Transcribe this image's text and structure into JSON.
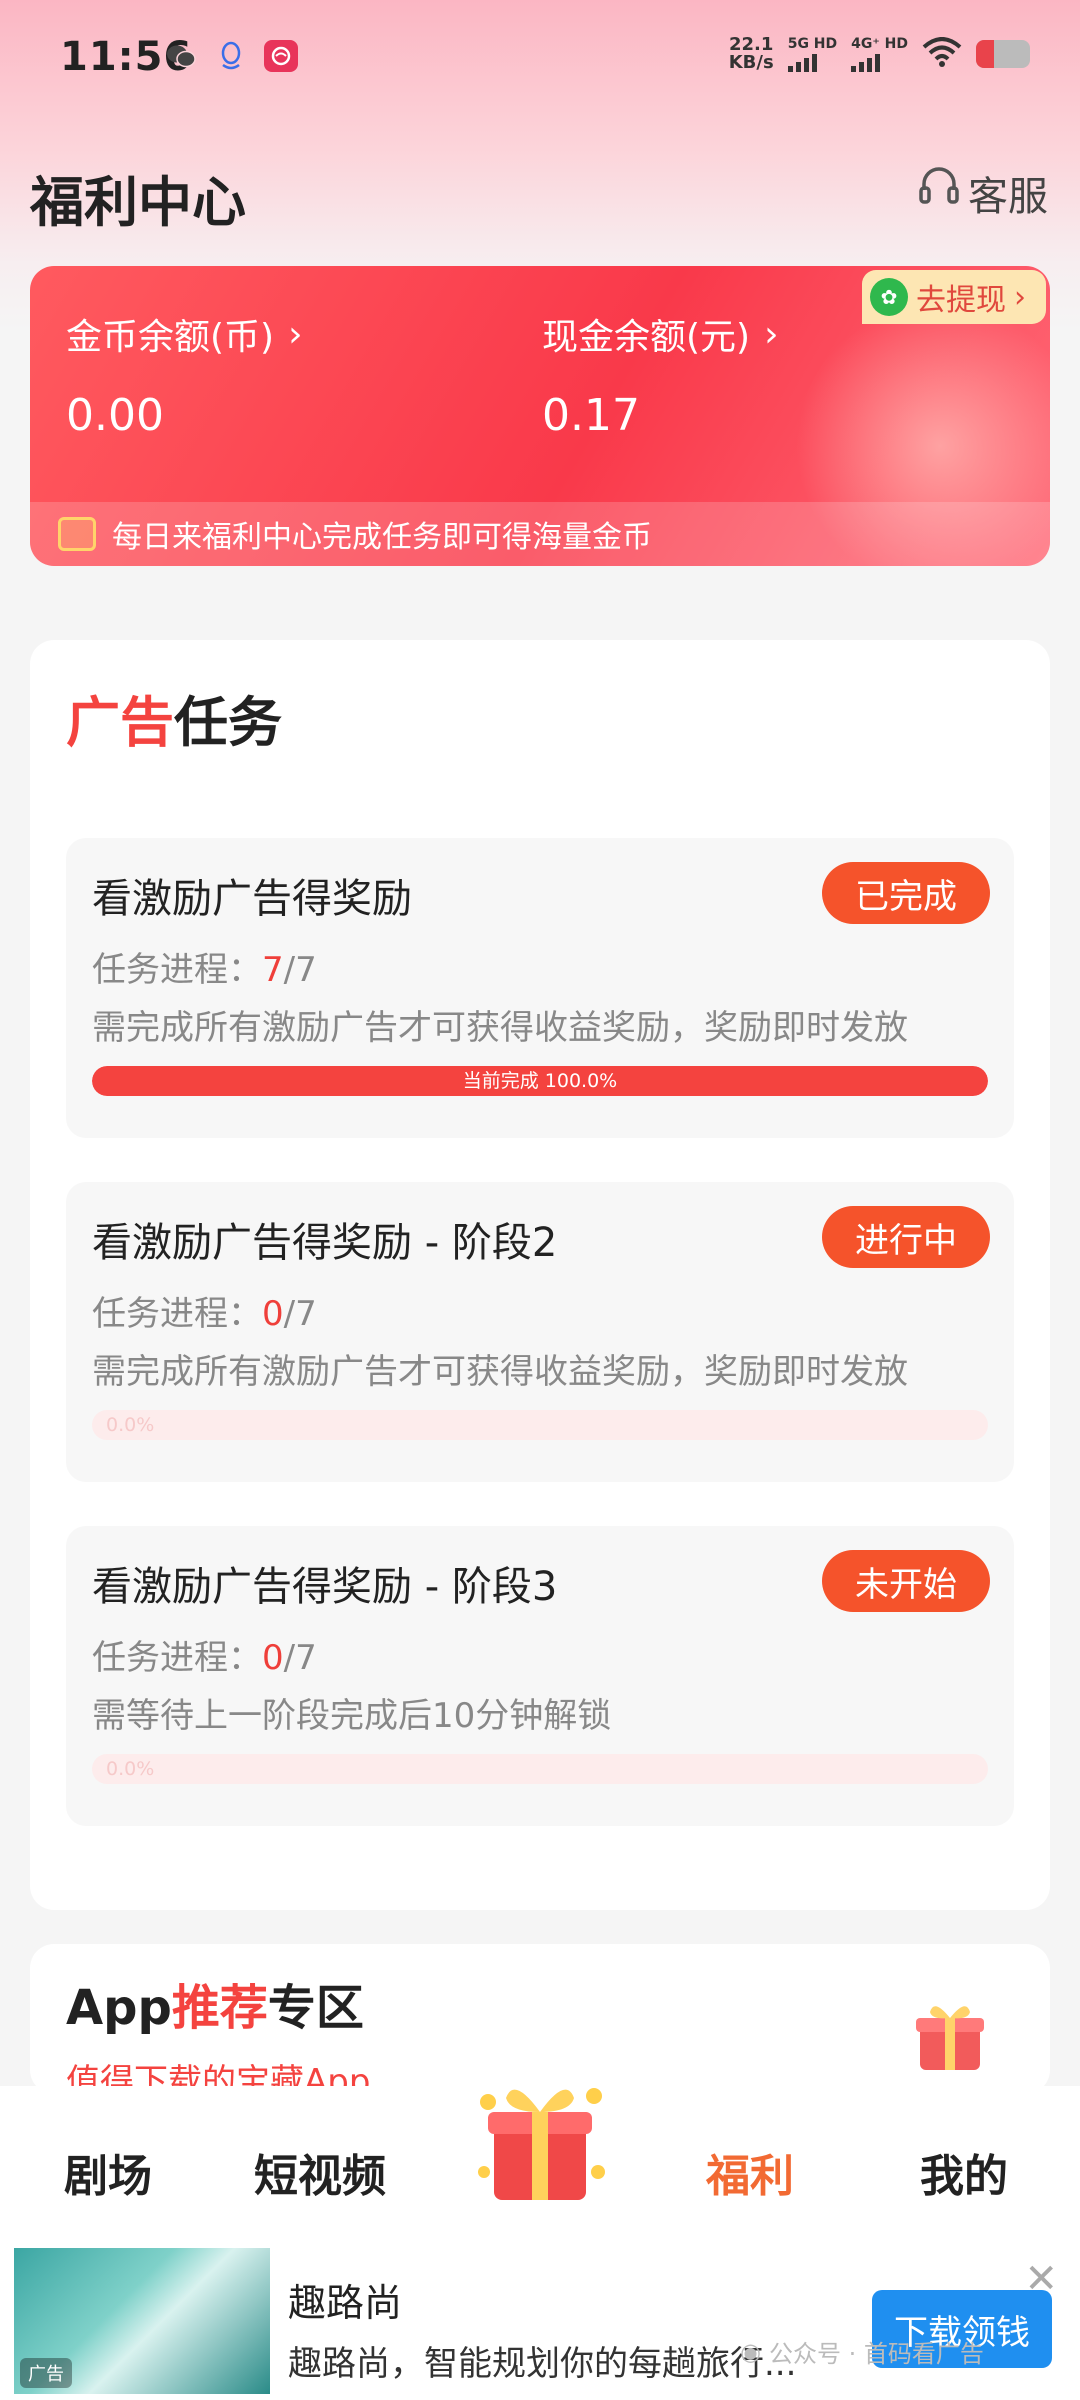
{
  "status_bar": {
    "time": "11:56",
    "net_speed_value": "22.1",
    "net_speed_unit": "KB/s",
    "sim1_label": "5G HD",
    "sim2_label": "4G⁺ HD",
    "icons": [
      "wechat-icon",
      "qq-icon",
      "app-icon",
      "wifi-icon",
      "battery-icon"
    ]
  },
  "header": {
    "title": "福利中心",
    "service_label": "客服"
  },
  "balance": {
    "coin_label": "金币余额(币)",
    "coin_value": "0.00",
    "cash_label": "现金余额(元)",
    "cash_value": "0.17",
    "withdraw_label": "去提现",
    "tip": "每日来福利中心完成任务即可得海量金币"
  },
  "ad_tasks": {
    "title_accent": "广告",
    "title_rest": "任务",
    "progress_label": "任务进程：",
    "items": [
      {
        "title": "看激励广告得奖励",
        "status": "已完成",
        "progress_done": "7",
        "progress_total": "/7",
        "desc": "需完成所有激励广告才可获得收益奖励，奖励即时发放",
        "bar_text": "当前完成 100.0%",
        "progress_fraction": 1.0
      },
      {
        "title": "看激励广告得奖励 - 阶段2",
        "status": "进行中",
        "progress_done": "0",
        "progress_total": "/7",
        "desc": "需完成所有激励广告才可获得收益奖励，奖励即时发放",
        "bar_text": "0.0%",
        "progress_fraction": 0.0
      },
      {
        "title": "看激励广告得奖励 - 阶段3",
        "status": "未开始",
        "progress_done": "0",
        "progress_total": "/7",
        "desc": "需等待上一阶段完成后10分钟解锁",
        "bar_text": "0.0%",
        "progress_fraction": 0.0
      }
    ]
  },
  "app_recommend": {
    "title_prefix": "App",
    "title_accent": "推荐",
    "title_suffix": "专区",
    "subtitle": "值得下载的宝藏App"
  },
  "bottom_nav": {
    "items": [
      "剧场",
      "短视频",
      "福利",
      "我的"
    ],
    "active": "福利"
  },
  "ad_banner": {
    "title": "趣路尚",
    "desc": "趣路尚，智能规划你的每趟旅行...",
    "cta": "下载领钱",
    "thumb_tag": "广告",
    "watermark": "公众号 · 首码看广告"
  },
  "colors": {
    "accent": "#f4433f",
    "badge": "#f5532b",
    "nav_active": "#f26a33",
    "cta_blue": "#1f8ff0"
  }
}
